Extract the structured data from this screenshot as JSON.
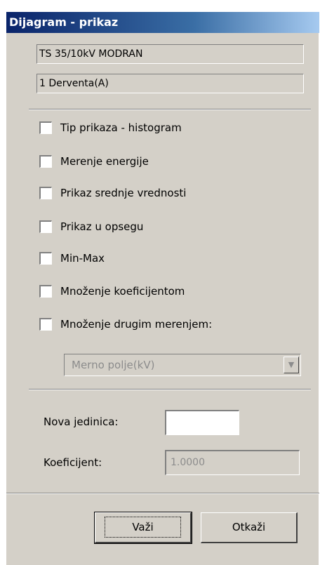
{
  "window": {
    "title": "Dijagram - prikaz"
  },
  "info": {
    "station": "TS 35/10kV MODRAN",
    "feeder": "1 Derventa(A)"
  },
  "options": [
    {
      "label": "Tip prikaza - histogram",
      "checked": false
    },
    {
      "label": "Merenje energije",
      "checked": false
    },
    {
      "label": "Prikaz srednje vrednosti",
      "checked": false
    },
    {
      "label": "Prikaz u opsegu",
      "checked": false
    },
    {
      "label": "Min-Max",
      "checked": false
    },
    {
      "label": "Množenje koeficijentom",
      "checked": false
    },
    {
      "label": "Množenje drugim merenjem:",
      "checked": false
    }
  ],
  "measure_select": {
    "value": "Merno polje(kV)",
    "enabled": false
  },
  "fields": {
    "new_unit_label": "Nova jedinica:",
    "new_unit_value": "",
    "coefficient_label": "Koeficijent:",
    "coefficient_value": "1.0000"
  },
  "buttons": {
    "ok": "Važi",
    "cancel": "Otkaži"
  }
}
